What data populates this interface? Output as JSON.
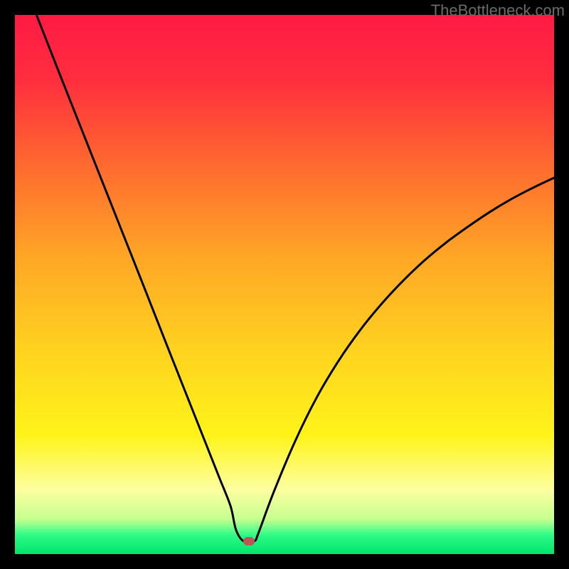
{
  "watermark": "TheBottleneck.com",
  "chart_data": {
    "type": "line",
    "title": "",
    "xlabel": "",
    "ylabel": "",
    "xlim": [
      0,
      100
    ],
    "ylim": [
      0,
      100
    ],
    "background_gradient": {
      "stops": [
        {
          "offset": 0.0,
          "color": "#ff1a44"
        },
        {
          "offset": 0.12,
          "color": "#ff2e3e"
        },
        {
          "offset": 0.28,
          "color": "#ff6a2f"
        },
        {
          "offset": 0.45,
          "color": "#ffa726"
        },
        {
          "offset": 0.62,
          "color": "#ffd21f"
        },
        {
          "offset": 0.78,
          "color": "#fff41a"
        },
        {
          "offset": 0.88,
          "color": "#fdffa0"
        },
        {
          "offset": 0.935,
          "color": "#c6ff90"
        },
        {
          "offset": 0.965,
          "color": "#2dfc87"
        },
        {
          "offset": 1.0,
          "color": "#00e46b"
        }
      ]
    },
    "series": [
      {
        "name": "bottleneck-curve",
        "x": [
          4.0,
          8.0,
          12.0,
          16.0,
          20.0,
          24.0,
          28.0,
          32.0,
          36.0,
          38.0,
          40.0,
          41.0,
          42.4,
          44.4,
          45.2,
          48.0,
          52.0,
          56.0,
          60.0,
          64.0,
          68.0,
          72.0,
          76.0,
          80.0,
          84.0,
          88.0,
          92.0,
          96.0,
          100.0
        ],
        "y": [
          100.0,
          89.8,
          79.7,
          69.6,
          59.5,
          49.4,
          39.2,
          29.1,
          19.0,
          13.95,
          8.88,
          4.5,
          2.4,
          2.4,
          4.0,
          11.5,
          21.0,
          29.1,
          35.8,
          41.5,
          46.4,
          50.7,
          54.5,
          57.8,
          60.7,
          63.4,
          65.8,
          67.9,
          69.8
        ]
      }
    ],
    "marker": {
      "x": 43.4,
      "y": 2.4,
      "color": "#b75a55"
    }
  }
}
